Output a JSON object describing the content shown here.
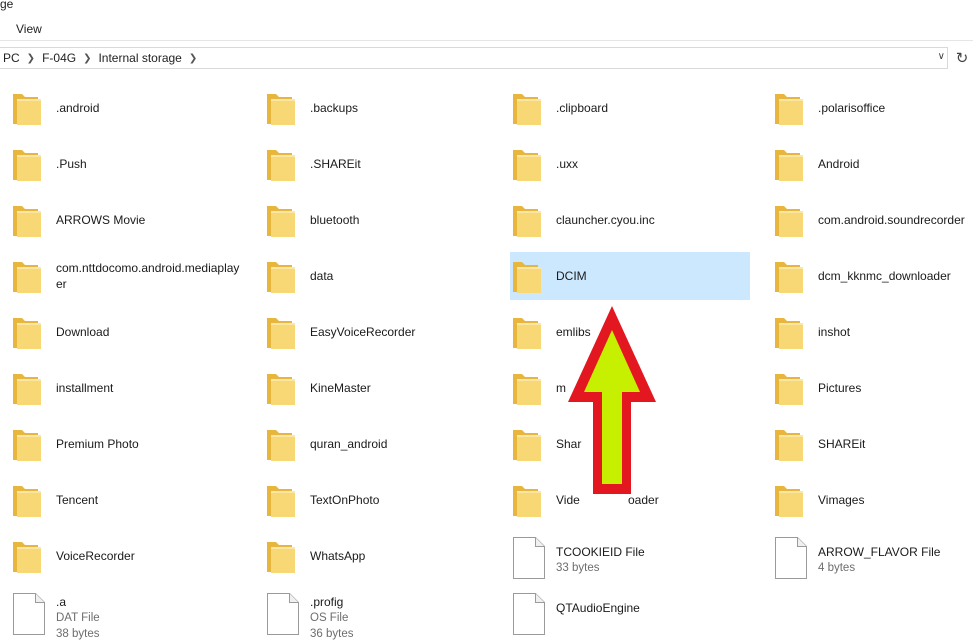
{
  "window": {
    "title_fragment": "ge"
  },
  "ribbon": {
    "view_tab": "View"
  },
  "address": {
    "crumbs": [
      "PC",
      "F-04G",
      "Internal storage"
    ]
  },
  "files": [
    {
      "name": ".android",
      "kind": "folder"
    },
    {
      "name": ".backups",
      "kind": "folder"
    },
    {
      "name": ".clipboard",
      "kind": "folder"
    },
    {
      "name": ".polarisoffice",
      "kind": "folder"
    },
    {
      "name": ".Push",
      "kind": "folder"
    },
    {
      "name": ".SHAREit",
      "kind": "folder"
    },
    {
      "name": ".uxx",
      "kind": "folder"
    },
    {
      "name": "Android",
      "kind": "folder"
    },
    {
      "name": "ARROWS Movie",
      "kind": "folder"
    },
    {
      "name": "bluetooth",
      "kind": "folder"
    },
    {
      "name": "clauncher.cyou.inc",
      "kind": "folder"
    },
    {
      "name": "com.android.soundrecorder",
      "kind": "folder"
    },
    {
      "name": "com.nttdocomo.android.mediaplayer",
      "kind": "folder"
    },
    {
      "name": "data",
      "kind": "folder"
    },
    {
      "name": "DCIM",
      "kind": "folder",
      "selected": true
    },
    {
      "name": "dcm_kknmc_downloader",
      "kind": "folder"
    },
    {
      "name": "Download",
      "kind": "folder"
    },
    {
      "name": "EasyVoiceRecorder",
      "kind": "folder"
    },
    {
      "name": "emlibs",
      "kind": "folder"
    },
    {
      "name": "inshot",
      "kind": "folder"
    },
    {
      "name": "installment",
      "kind": "folder"
    },
    {
      "name": "KineMaster",
      "kind": "folder"
    },
    {
      "name": "m",
      "kind": "folder"
    },
    {
      "name": "Pictures",
      "kind": "folder"
    },
    {
      "name": "Premium Photo",
      "kind": "folder"
    },
    {
      "name": "quran_android",
      "kind": "folder"
    },
    {
      "name": "Shar",
      "kind": "folder"
    },
    {
      "name": "SHAREit",
      "kind": "folder"
    },
    {
      "name": "Tencent",
      "kind": "folder"
    },
    {
      "name": "TextOnPhoto",
      "kind": "folder"
    },
    {
      "name": "Vide",
      "name_tail": "oader",
      "kind": "folder"
    },
    {
      "name": "Vimages",
      "kind": "folder"
    },
    {
      "name": "VoiceRecorder",
      "kind": "folder"
    },
    {
      "name": "WhatsApp",
      "kind": "folder"
    },
    {
      "name": "TCOOKIEID File",
      "kind": "file",
      "size": "33 bytes"
    },
    {
      "name": "ARROW_FLAVOR File",
      "kind": "file",
      "size": "4 bytes"
    },
    {
      "name": ".a",
      "kind": "file",
      "type": "DAT File",
      "size": "38 bytes"
    },
    {
      "name": ".profig",
      "kind": "file",
      "type": "OS File",
      "size": "36 bytes"
    },
    {
      "name": "QTAudioEngine",
      "kind": "file"
    }
  ],
  "colors": {
    "selection": "#cce8ff",
    "folder_back": "#e8b63c",
    "folder_front": "#f8d775",
    "annotation_arrow_stroke": "#e3171f",
    "annotation_arrow_fill": "#c6f000"
  },
  "icons": {
    "folder": "folder-icon",
    "file": "file-icon",
    "refresh": "refresh-icon",
    "chevron": "chevron-down-icon"
  }
}
